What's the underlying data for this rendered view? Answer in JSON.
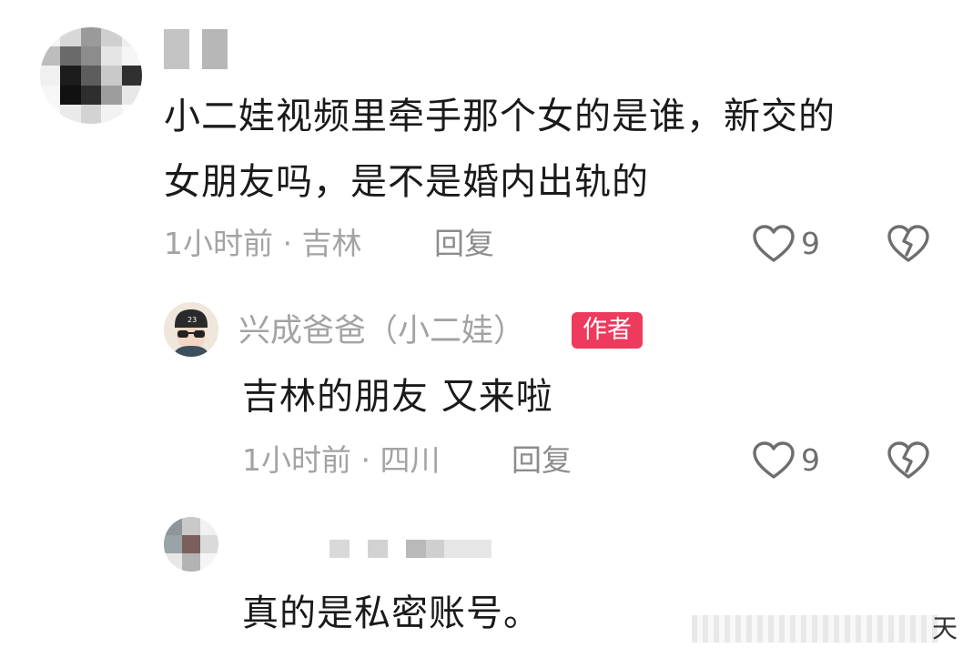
{
  "comments": [
    {
      "text_line1": "小二娃视频里牵手那个女的是谁，新交的",
      "text_line2": "女朋友吗，是不是婚内出轨的",
      "meta": "1小时前 · 吉林",
      "reply_label": "回复",
      "likes": "9"
    }
  ],
  "reply": {
    "username": "兴成爸爸（小二娃）",
    "badge": "作者",
    "text": "吉林的朋友 又来啦",
    "meta": "1小时前 · 四川",
    "reply_label": "回复",
    "likes": "9"
  },
  "comment3": {
    "text": "真的是私密账号。"
  },
  "watermark_char": "天",
  "icons": {
    "like": "heart-outline-icon",
    "dislike": "broken-heart-icon"
  },
  "colors": {
    "text": "#1a1a1a",
    "meta": "#a3a3a3",
    "badge": "#ee3a5c",
    "icon": "#6e6e6e"
  }
}
